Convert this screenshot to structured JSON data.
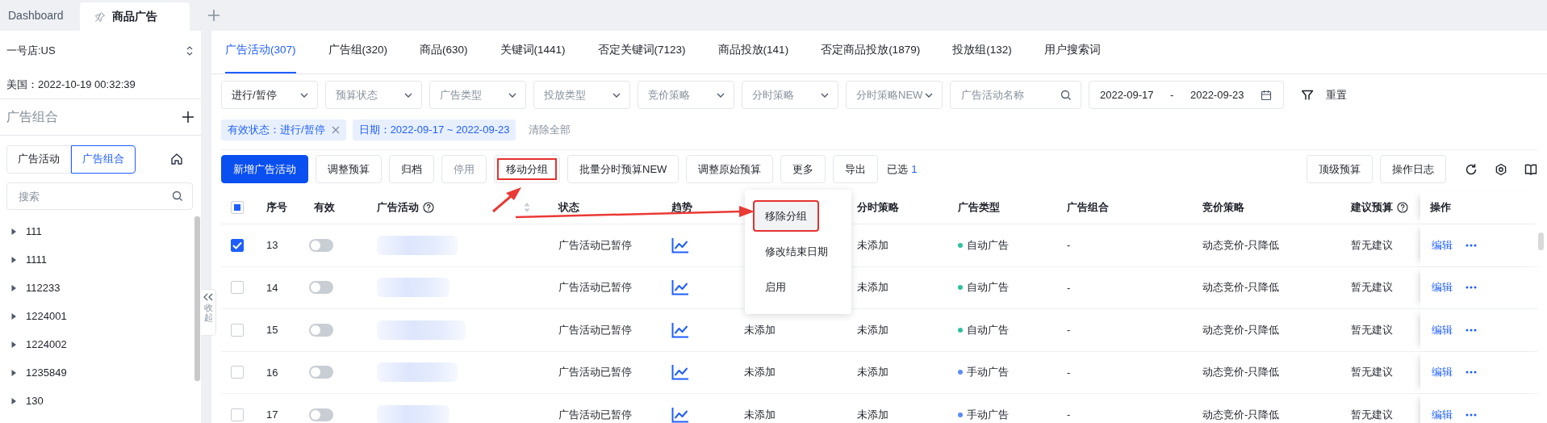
{
  "top_tabs": [
    {
      "label": "Dashboard",
      "selected": false,
      "pinned": false
    },
    {
      "label": "商品广告",
      "selected": true,
      "pinned": true
    }
  ],
  "sidebar": {
    "store": "一号店:US",
    "time": "美国：2022-10-19 00:32:39",
    "section_title": "广告组合",
    "segments": [
      {
        "label": "广告活动",
        "selected": false
      },
      {
        "label": "广告组合",
        "selected": true
      }
    ],
    "search": {
      "placeholder": "搜索"
    },
    "tree": [
      {
        "label": "111",
        "expanded": false
      },
      {
        "label": "1111",
        "expanded": false
      },
      {
        "label": "112233",
        "expanded": false
      },
      {
        "label": "1224001",
        "expanded": false
      },
      {
        "label": "1224002",
        "expanded": false
      },
      {
        "label": "1235849",
        "expanded": false
      },
      {
        "label": "130",
        "expanded": false
      }
    ],
    "collapse_label": "收起"
  },
  "main": {
    "tabs": [
      {
        "label": "广告活动(307)",
        "selected": true
      },
      {
        "label": "广告组(320)",
        "selected": false
      },
      {
        "label": "商品(630)",
        "selected": false
      },
      {
        "label": "关键词(1441)",
        "selected": false
      },
      {
        "label": "否定关键词(7123)",
        "selected": false
      },
      {
        "label": "商品投放(141)",
        "selected": false
      },
      {
        "label": "否定商品投放(1879)",
        "selected": false
      },
      {
        "label": "投放组(132)",
        "selected": false
      },
      {
        "label": "用户搜索词",
        "selected": false
      }
    ],
    "filters": [
      {
        "kind": "select",
        "value": "进行/暂停"
      },
      {
        "kind": "select",
        "placeholder": "预算状态"
      },
      {
        "kind": "select",
        "placeholder": "广告类型"
      },
      {
        "kind": "select",
        "placeholder": "投放类型"
      },
      {
        "kind": "select",
        "placeholder": "竞价策略"
      },
      {
        "kind": "select",
        "placeholder": "分时策略"
      },
      {
        "kind": "select",
        "placeholder": "分时策略NEW"
      },
      {
        "kind": "search",
        "placeholder": "广告活动名称"
      },
      {
        "kind": "date_range",
        "start": "2022-09-17",
        "separator": "-",
        "end": "2022-09-23"
      }
    ],
    "reset": "重置",
    "active_filters": [
      {
        "label": "有效状态：进行/暂停",
        "closable": true
      },
      {
        "label": "日期：2022-09-17 ~ 2022-09-23",
        "closable": false
      }
    ],
    "clear_all": "清除全部",
    "actions": [
      {
        "label": "新增广告活动",
        "kind": "primary",
        "highlighted": false
      },
      {
        "label": "调整预算",
        "kind": "default",
        "highlighted": false
      },
      {
        "label": "归档",
        "kind": "default",
        "highlighted": false
      },
      {
        "label": "停用",
        "kind": "disabled",
        "highlighted": false
      },
      {
        "label": "移动分组",
        "kind": "default",
        "highlighted": true
      },
      {
        "label": "批量分时预算NEW",
        "kind": "default",
        "highlighted": false
      },
      {
        "label": "调整原始预算",
        "kind": "default",
        "highlighted": false
      },
      {
        "label": "更多",
        "kind": "default",
        "highlighted": false
      },
      {
        "label": "导出",
        "kind": "default",
        "highlighted": false
      }
    ],
    "selection": {
      "label": "已选",
      "count": "1"
    },
    "right_actions": [
      {
        "label": "顶级预算"
      },
      {
        "label": "操作日志"
      }
    ],
    "more_menu": [
      {
        "label": "移除分组",
        "highlighted": true
      },
      {
        "label": "修改结束日期",
        "highlighted": false
      },
      {
        "label": "启用",
        "highlighted": false
      }
    ],
    "table": {
      "select_all_indeterminate": true,
      "columns": [
        {
          "label": "序号"
        },
        {
          "label": "有效"
        },
        {
          "label": "广告活动",
          "help": true,
          "sortable": true
        },
        {
          "label": "状态"
        },
        {
          "label": "趋势"
        },
        {
          "label": "分时策略"
        },
        {
          "label": "广告类型"
        },
        {
          "label": "广告组合"
        },
        {
          "label": "竞价策略"
        },
        {
          "label": "建议预算",
          "help": true
        },
        {
          "label": "操作"
        }
      ],
      "rows": [
        {
          "selected": true,
          "index": "13",
          "enabled": false,
          "campaign_blurred": true,
          "status": "广告活动已暂停",
          "time_strategy": "未添加",
          "ad_type": {
            "label": "自动广告",
            "color": "#2fc1a0"
          },
          "portfolio": "-",
          "bidding": "动态竞价-只降低",
          "suggested_budget": "暂无建议",
          "edit": "编辑"
        },
        {
          "selected": false,
          "index": "14",
          "enabled": false,
          "campaign_blurred": true,
          "status": "广告活动已暂停",
          "time_strategy": "未添加",
          "ad_type": {
            "label": "自动广告",
            "color": "#2fc1a0"
          },
          "portfolio": "-",
          "bidding": "动态竞价-只降低",
          "suggested_budget": "暂无建议",
          "edit": "编辑"
        },
        {
          "selected": false,
          "index": "15",
          "enabled": false,
          "campaign_blurred": true,
          "status": "广告活动已暂停",
          "column_7": "未添加",
          "time_strategy": "未添加",
          "ad_type": {
            "label": "自动广告",
            "color": "#2fc1a0"
          },
          "portfolio": "-",
          "bidding": "动态竞价-只降低",
          "suggested_budget": "暂无建议",
          "edit": "编辑"
        },
        {
          "selected": false,
          "index": "16",
          "enabled": false,
          "campaign_blurred": true,
          "status": "广告活动已暂停",
          "column_7": "未添加",
          "time_strategy": "未添加",
          "ad_type": {
            "label": "手动广告",
            "color": "#5b8cf7"
          },
          "portfolio": "-",
          "bidding": "动态竞价-只降低",
          "suggested_budget": "暂无建议",
          "edit": "编辑"
        },
        {
          "selected": false,
          "index": "17",
          "enabled": false,
          "campaign_blurred": true,
          "status": "广告活动已暂停",
          "column_7": "未添加",
          "time_strategy": "未添加",
          "ad_type": {
            "label": "手动广告",
            "color": "#5b8cf7"
          },
          "portfolio": "-",
          "bidding": "动态竞价-只降低",
          "suggested_budget": "暂无建议",
          "edit": "编辑"
        }
      ]
    }
  }
}
